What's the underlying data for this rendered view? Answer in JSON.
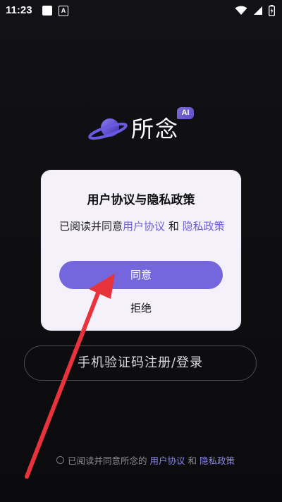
{
  "status_bar": {
    "time": "11:23"
  },
  "app": {
    "name": "所念",
    "badge": "AI"
  },
  "dialog": {
    "title": "用户协议与隐私政策",
    "body_prefix": "已阅读并同意",
    "link_user_agreement": "用户协议",
    "and": "和",
    "link_privacy_policy": "隐私政策",
    "agree_label": "同意",
    "reject_label": "拒绝"
  },
  "login": {
    "phone_button_label": "手机验证码注册/登录"
  },
  "agreement_row": {
    "text": "已阅读并同意所念的",
    "link_user_agreement": "用户协议",
    "and": "和",
    "link_privacy_policy": "隐私政策"
  },
  "colors": {
    "accent": "#7467dd",
    "link": "#6b5ed4",
    "dialog_bg": "#f4f1fb",
    "annotation_arrow": "#e8323c"
  }
}
